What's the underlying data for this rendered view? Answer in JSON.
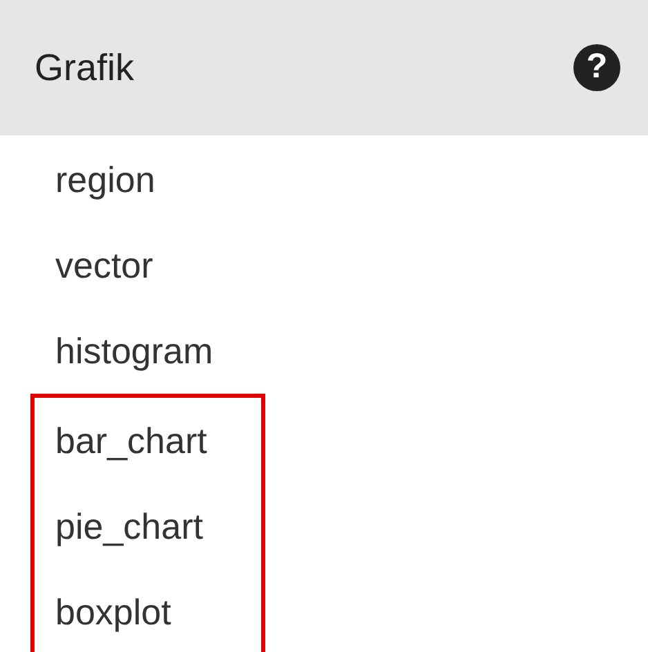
{
  "header": {
    "title": "Grafik",
    "help": "?"
  },
  "items": [
    {
      "label": "region",
      "highlighted": false
    },
    {
      "label": "vector",
      "highlighted": false
    },
    {
      "label": "histogram",
      "highlighted": false
    },
    {
      "label": "bar_chart",
      "highlighted": true
    },
    {
      "label": "pie_chart",
      "highlighted": true
    },
    {
      "label": "boxplot",
      "highlighted": true
    }
  ]
}
